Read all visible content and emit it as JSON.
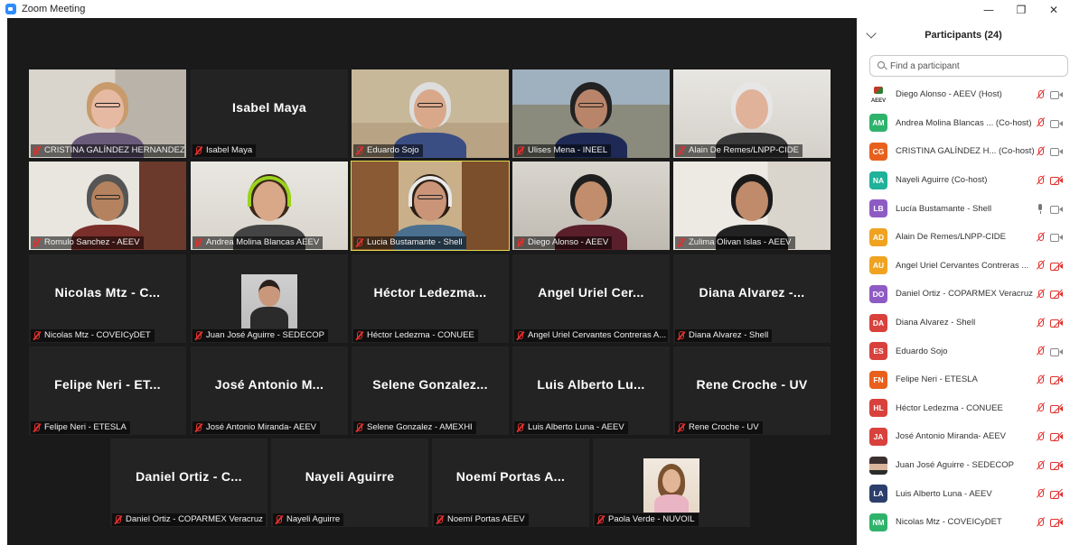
{
  "window": {
    "title": "Zoom Meeting",
    "controls": {
      "minimize": "—",
      "restore": "❐",
      "close": "✕"
    }
  },
  "tiles": [
    {
      "big": "",
      "label": "CRISTINA GALÍNDEZ HERNANDEZ",
      "video": "cristina"
    },
    {
      "big": "Isabel Maya",
      "label": "Isabel Maya",
      "video": ""
    },
    {
      "big": "",
      "label": "Eduardo Sojo",
      "video": "eduardo"
    },
    {
      "big": "",
      "label": "Ulises Mena - INEEL",
      "video": "ulises"
    },
    {
      "big": "",
      "label": "Alain De Remes/LNPP-CIDE",
      "video": "alain"
    },
    {
      "big": "",
      "label": "Romulo Sanchez - AEEV",
      "video": "romulo"
    },
    {
      "big": "",
      "label": "Andrea Molina Blancas AEEV",
      "video": "andrea"
    },
    {
      "big": "",
      "label": "Lucia Bustamante - Shell",
      "video": "lucia"
    },
    {
      "big": "",
      "label": "Diego Alonso - AEEV",
      "video": "diego"
    },
    {
      "big": "",
      "label": "Zulima Olivan Islas - AEEV",
      "video": "zulima"
    },
    {
      "big": "Nicolas Mtz - C...",
      "label": "Nicolas Mtz - COVEICyDET",
      "video": ""
    },
    {
      "big": "",
      "label": "Juan José Aguirre - SEDECOP",
      "video": "juanthumb"
    },
    {
      "big": "Héctor Ledezma...",
      "label": "Héctor Ledezma - CONUEE",
      "video": ""
    },
    {
      "big": "Angel Uriel Cer...",
      "label": "Angel Uriel Cervantes Contreras A...",
      "video": ""
    },
    {
      "big": "Diana Alvarez -...",
      "label": "Diana Alvarez - Shell",
      "video": ""
    },
    {
      "big": "Felipe Neri - ET...",
      "label": "Felipe Neri - ETESLA",
      "video": ""
    },
    {
      "big": "José Antonio M...",
      "label": "José Antonio Miranda- AEEV",
      "video": ""
    },
    {
      "big": "Selene Gonzalez...",
      "label": "Selene Gonzalez - AMEXHI",
      "video": ""
    },
    {
      "big": "Luis Alberto Lu...",
      "label": "Luis Alberto Luna - AEEV",
      "video": ""
    },
    {
      "big": "Rene Croche - UV",
      "label": "Rene Croche - UV",
      "video": ""
    },
    {
      "big": "Daniel Ortiz - C...",
      "label": "Daniel Ortiz - COPARMEX Veracruz",
      "video": ""
    },
    {
      "big": "Nayeli Aguirre",
      "label": "Nayeli Aguirre",
      "video": ""
    },
    {
      "big": "Noemí Portas A...",
      "label": "Noemí Portas AEEV",
      "video": ""
    },
    {
      "big": "",
      "label": "Paola Verde - NUVOIL",
      "video": "paolathumb"
    }
  ],
  "active_speaker": "Lucia Bustamante - Shell",
  "participants_panel": {
    "title": "Participants (24)",
    "search_placeholder": "Find a participant",
    "list": [
      {
        "initials": "AEEV",
        "name": "Diego Alonso - AEEV (Host)",
        "color": "#ffffff",
        "avatar": "logo",
        "mic": "muted",
        "cam": "on"
      },
      {
        "initials": "AM",
        "name": "Andrea Molina Blancas ... (Co-host)",
        "color": "#2fb36b",
        "avatar": "initials",
        "mic": "muted",
        "cam": "on"
      },
      {
        "initials": "CG",
        "name": "CRISTINA GALÍNDEZ H... (Co-host)",
        "color": "#e8601c",
        "avatar": "initials",
        "mic": "muted",
        "cam": "on"
      },
      {
        "initials": "NA",
        "name": "Nayeli Aguirre (Co-host)",
        "color": "#1fb199",
        "avatar": "initials",
        "mic": "muted",
        "cam": "off"
      },
      {
        "initials": "LB",
        "name": "Lucía Bustamante - Shell",
        "color": "#8e5bc4",
        "avatar": "initials",
        "mic": "live",
        "cam": "on"
      },
      {
        "initials": "AD",
        "name": "Alain De Remes/LNPP-CIDE",
        "color": "#f0a321",
        "avatar": "initials",
        "mic": "muted",
        "cam": "on"
      },
      {
        "initials": "AU",
        "name": "Angel Uriel Cervantes Contreras ...",
        "color": "#f0a321",
        "avatar": "initials",
        "mic": "muted",
        "cam": "off"
      },
      {
        "initials": "DO",
        "name": "Daniel Ortiz - COPARMEX Veracruz",
        "color": "#8e5bc4",
        "avatar": "initials",
        "mic": "muted",
        "cam": "off"
      },
      {
        "initials": "DA",
        "name": "Diana Alvarez - Shell",
        "color": "#d8413c",
        "avatar": "initials",
        "mic": "muted",
        "cam": "off"
      },
      {
        "initials": "ES",
        "name": "Eduardo Sojo",
        "color": "#d8413c",
        "avatar": "initials",
        "mic": "muted",
        "cam": "on"
      },
      {
        "initials": "FN",
        "name": "Felipe Neri - ETESLA",
        "color": "#e8601c",
        "avatar": "initials",
        "mic": "muted",
        "cam": "off"
      },
      {
        "initials": "HL",
        "name": "Héctor Ledezma - CONUEE",
        "color": "#d8413c",
        "avatar": "initials",
        "mic": "muted",
        "cam": "off"
      },
      {
        "initials": "JA",
        "name": "José Antonio Miranda- AEEV",
        "color": "#d8413c",
        "avatar": "initials",
        "mic": "muted",
        "cam": "off"
      },
      {
        "initials": "",
        "name": "Juan José Aguirre - SEDECOP",
        "color": "#555555",
        "avatar": "photo",
        "mic": "muted",
        "cam": "off"
      },
      {
        "initials": "LA",
        "name": "Luis Alberto Luna - AEEV",
        "color": "#2c3e6b",
        "avatar": "initials",
        "mic": "muted",
        "cam": "off"
      },
      {
        "initials": "NM",
        "name": "Nicolas Mtz - COVEICyDET",
        "color": "#2fb36b",
        "avatar": "initials",
        "mic": "muted",
        "cam": "off"
      }
    ]
  }
}
